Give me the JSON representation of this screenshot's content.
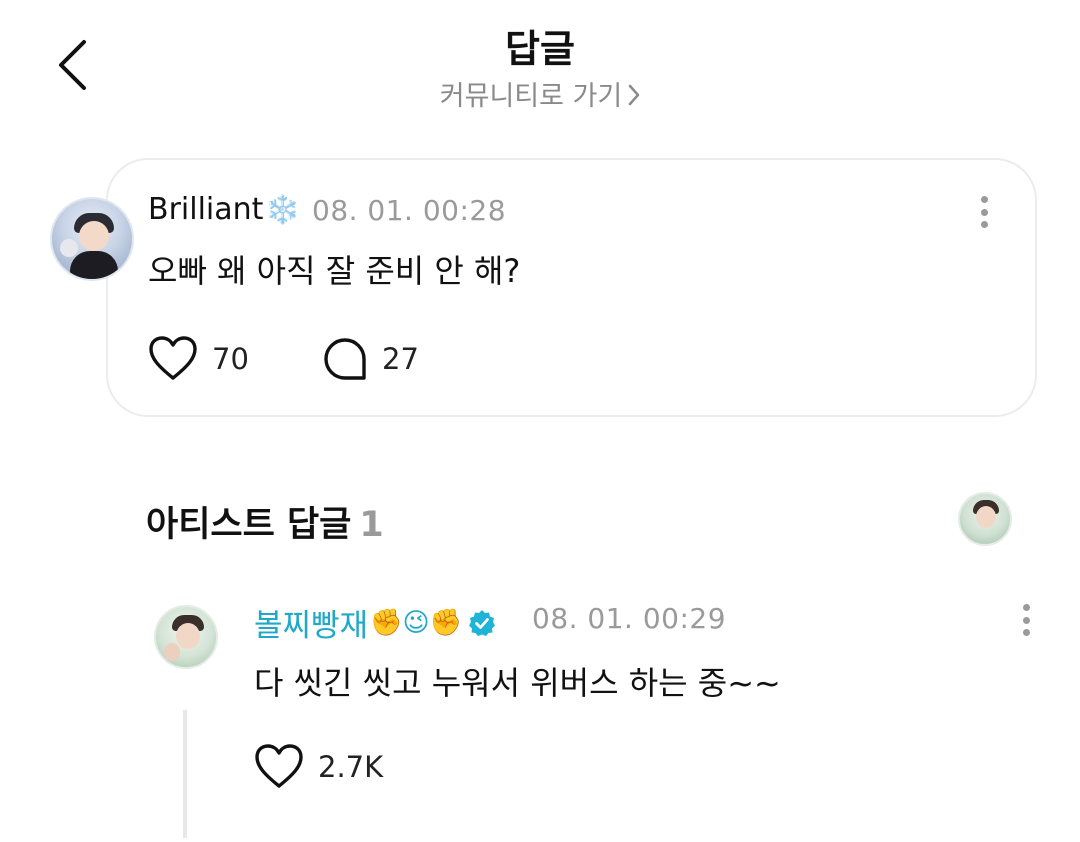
{
  "header": {
    "title": "답글",
    "community_link": "커뮤니티로 가기"
  },
  "post": {
    "username": "Brilliant",
    "username_emoji": "❄️",
    "timestamp": "08. 01. 00:28",
    "text": "오빠 왜 아직 잘 준비 안 해?",
    "likes": "70",
    "comments": "27"
  },
  "artist_section": {
    "title": "아티스트 답글",
    "count": "1"
  },
  "reply": {
    "username": "볼찌빵재",
    "username_emojis": "✊😉✊",
    "verified": true,
    "timestamp": "08. 01. 00:29",
    "text": "다 씻긴 씻고 누워서 위버스 하는 중~~",
    "likes": "2.7K"
  },
  "colors": {
    "artist_name": "#1fa8c9",
    "muted_text": "#9a9a9a",
    "card_border": "#ececec",
    "verified_badge": "#1fb3d6"
  }
}
